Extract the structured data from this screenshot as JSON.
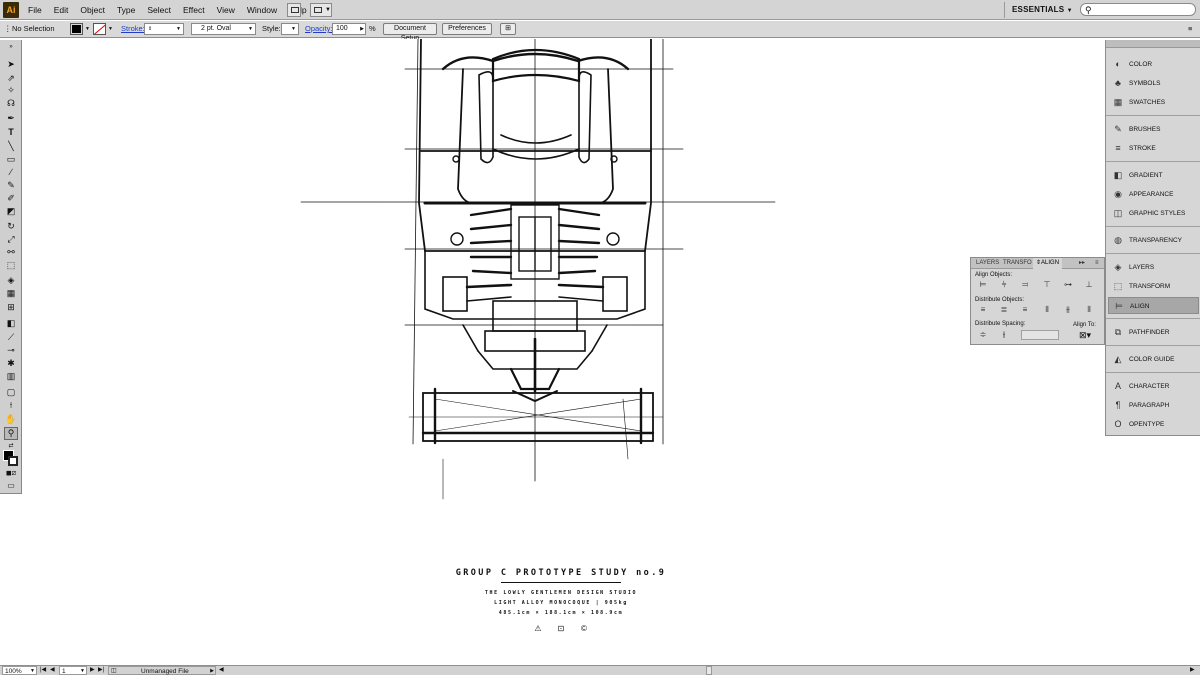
{
  "app": {
    "logo": "Ai"
  },
  "menu": [
    "File",
    "Edit",
    "Object",
    "Type",
    "Select",
    "Effect",
    "View",
    "Window",
    "Help"
  ],
  "workspace": "ESSENTIALS",
  "search": {
    "placeholder": "",
    "icon": "search-icon"
  },
  "control_bar": {
    "selection_label": "No Selection",
    "fill_color": "#000000",
    "stroke_label": "Stroke:",
    "brush_value": "2 pt. Oval",
    "style_label": "Style:",
    "opacity_label": "Opacity:",
    "opacity_value": "100",
    "opacity_unit": "%",
    "document_setup": "Document Setup",
    "preferences": "Preferences"
  },
  "artwork": {
    "title": "GROUP C PROTOTYPE STUDY no.9",
    "line1": "THE LOWLY GENTLEMEN DESIGN STUDIO",
    "line2": "LIGHT ALLOY MONOCOQUE | 905kg",
    "line3": "485.1cm × 188.1cm × 108.9cm",
    "marks": [
      "⚠",
      "⊡",
      "©"
    ]
  },
  "status_bar": {
    "zoom": "100%",
    "artboard": "1",
    "status": "Unmanaged File"
  },
  "dock": {
    "groups": [
      [
        {
          "label": "COLOR",
          "icon": "color-icon"
        },
        {
          "label": "SYMBOLS",
          "icon": "symbols-icon"
        },
        {
          "label": "SWATCHES",
          "icon": "swatches-icon"
        }
      ],
      [
        {
          "label": "BRUSHES",
          "icon": "brushes-icon"
        },
        {
          "label": "STROKE",
          "icon": "stroke-icon"
        }
      ],
      [
        {
          "label": "GRADIENT",
          "icon": "gradient-icon"
        },
        {
          "label": "APPEARANCE",
          "icon": "appearance-icon"
        },
        {
          "label": "GRAPHIC STYLES",
          "icon": "graphic-styles-icon"
        }
      ],
      [
        {
          "label": "TRANSPARENCY",
          "icon": "transparency-icon"
        }
      ],
      [
        {
          "label": "LAYERS",
          "icon": "layers-icon"
        },
        {
          "label": "TRANSFORM",
          "icon": "transform-icon"
        },
        {
          "label": "ALIGN",
          "icon": "align-icon",
          "active": true
        }
      ],
      [
        {
          "label": "PATHFINDER",
          "icon": "pathfinder-icon"
        }
      ],
      [
        {
          "label": "COLOR GUIDE",
          "icon": "color-guide-icon"
        }
      ],
      [
        {
          "label": "CHARACTER",
          "icon": "character-icon"
        },
        {
          "label": "PARAGRAPH",
          "icon": "paragraph-icon"
        },
        {
          "label": "OPENTYPE",
          "icon": "opentype-icon"
        }
      ]
    ]
  },
  "align_panel": {
    "tabs": [
      "LAYERS",
      "TRANSFO",
      "ALIGN"
    ],
    "align_objects_label": "Align Objects:",
    "distribute_objects_label": "Distribute Objects:",
    "distribute_spacing_label": "Distribute Spacing:",
    "align_to_label": "Align To:"
  }
}
